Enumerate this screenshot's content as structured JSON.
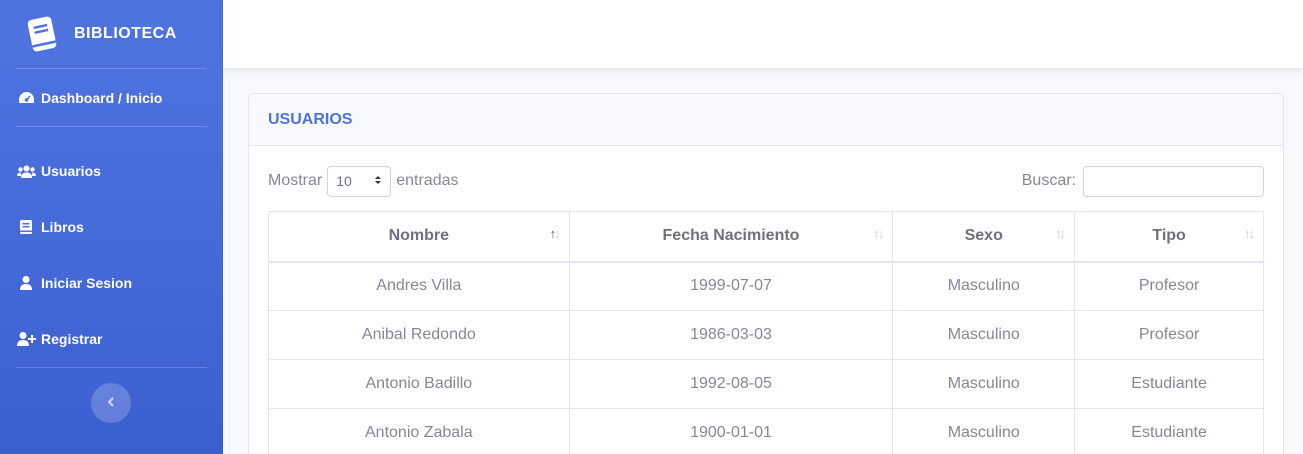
{
  "brand": {
    "name": "BIBLIOTECA",
    "icon": "book-icon"
  },
  "sidebar": {
    "items": [
      {
        "label": "Dashboard / Inicio",
        "icon": "tachometer-icon"
      },
      {
        "label": "Usuarios",
        "icon": "users-icon"
      },
      {
        "label": "Libros",
        "icon": "book-icon"
      },
      {
        "label": "Iniciar Sesion",
        "icon": "user-icon"
      },
      {
        "label": "Registrar",
        "icon": "user-plus-icon"
      }
    ],
    "toggle_icon": "chevron-left-icon"
  },
  "card": {
    "title": "USUARIOS"
  },
  "table_controls": {
    "show_label": "Mostrar",
    "page_length": "10",
    "entries_label": "entradas",
    "search_label": "Buscar:",
    "search_value": ""
  },
  "table": {
    "columns": [
      "Nombre",
      "Fecha Nacimiento",
      "Sexo",
      "Tipo"
    ],
    "rows": [
      [
        "Andres Villa",
        "1999-07-07",
        "Masculino",
        "Profesor"
      ],
      [
        "Anibal Redondo",
        "1986-03-03",
        "Masculino",
        "Profesor"
      ],
      [
        "Antonio Badillo",
        "1992-08-05",
        "Masculino",
        "Estudiante"
      ],
      [
        "Antonio Zabala",
        "1900-01-01",
        "Masculino",
        "Estudiante"
      ]
    ]
  },
  "colors": {
    "primary": "#4e73df",
    "text": "#858796",
    "border": "#e3e6f0"
  }
}
